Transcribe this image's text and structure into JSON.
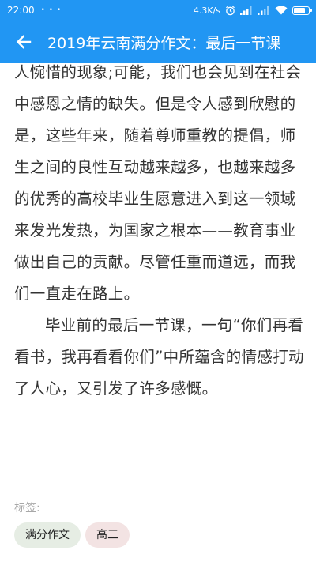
{
  "status_bar": {
    "time": "22:00",
    "dots": "• • •",
    "net_speed": "4.3K/s"
  },
  "app_bar": {
    "title": "2019年云南满分作文：最后一节课",
    "back_icon": "arrow-left-icon"
  },
  "article": {
    "paragraphs": [
      {
        "text": "人惋惜的现象;可能，我们也会见到在社会中感恩之情的缺失。但是令人感到欣慰的是，这些年来，随着尊师重教的提倡，师生之间的良性互动越来越多，也越来越多的优秀的高校毕业生愿意进入到这一领域来发光发热，为国家之根本——教育事业做出自己的贡献。尽管任重而道远，而我们一直走在路上。",
        "indent": false
      },
      {
        "text": "毕业前的最后一节课，一句“你们再看看书，我再看看你们”中所蕴含的情感打动了人心，又引发了许多感慨。",
        "indent": true
      }
    ]
  },
  "tags": {
    "label": "标签:",
    "items": [
      {
        "label": "满分作文",
        "bg": "#e6ede4"
      },
      {
        "label": "高三",
        "bg": "#f3e3e3"
      }
    ]
  },
  "colors": {
    "primary": "#2196f3",
    "text": "#333333",
    "muted": "#a8a8a8"
  }
}
